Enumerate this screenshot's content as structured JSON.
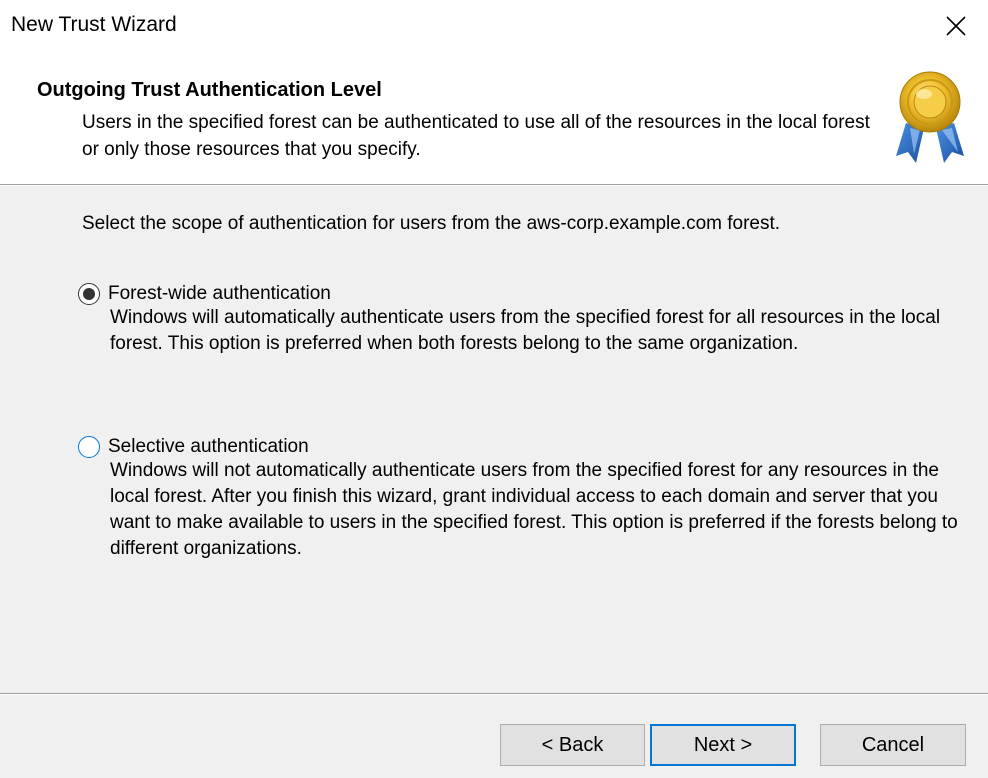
{
  "window": {
    "title": "New Trust Wizard"
  },
  "header": {
    "title": "Outgoing Trust Authentication Level",
    "description": "Users in the specified forest can be authenticated to use all of the resources in the local forest or only those resources that you specify.",
    "icon": "award-ribbon-icon"
  },
  "main": {
    "instruction": "Select the scope of authentication for users from the aws-corp.example.com forest.",
    "options": [
      {
        "label": "Forest-wide authentication",
        "description": "Windows will automatically authenticate users from the specified forest for all resources in the local forest. This option is preferred when both forests belong to the same organization.",
        "checked": true
      },
      {
        "label": "Selective authentication",
        "description": "Windows will not automatically authenticate users from the specified forest for any resources in the local forest. After you finish this wizard, grant individual access to each domain and server that you want to make available to users in the specified forest. This option is preferred if the forests belong to different organizations.",
        "checked": false
      }
    ]
  },
  "footer": {
    "back_label": "< Back",
    "next_label": "Next >",
    "cancel_label": "Cancel"
  },
  "colors": {
    "focus_blue": "#0078d7",
    "dialog_bg": "#f0f0f0",
    "header_bg": "#ffffff"
  }
}
